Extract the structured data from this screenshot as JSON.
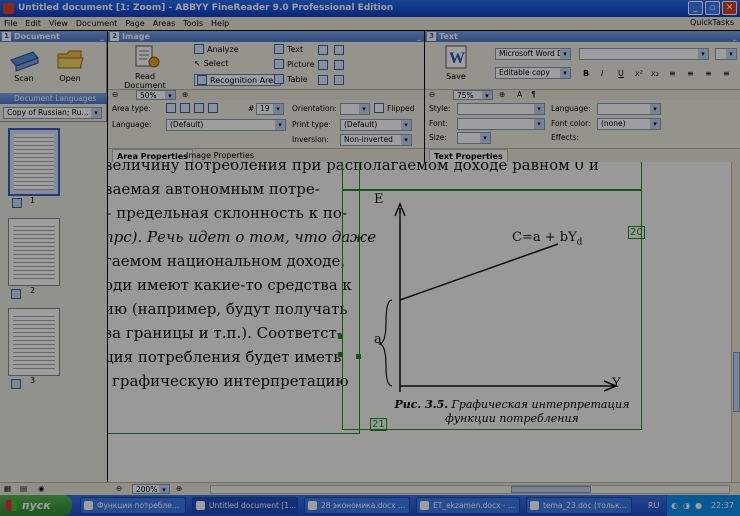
{
  "window": {
    "title": "Untitled document [1: Zoom] - ABBYY FineReader 9.0 Professional Edition",
    "min": "_",
    "max": "▫",
    "close": "✕"
  },
  "menu": {
    "items": [
      "File",
      "Edit",
      "View",
      "Document",
      "Page",
      "Areas",
      "Tools",
      "Help"
    ],
    "quicktasks": "QuickTasks"
  },
  "panels": {
    "document": {
      "num": "1",
      "title": "Document"
    },
    "image": {
      "num": "2",
      "title": "Image"
    },
    "text": {
      "num": "3",
      "title": "Text"
    }
  },
  "document_toolbar": {
    "scan": "Scan",
    "open": "Open",
    "languages_header": "Document Languages",
    "language_combo": "Copy of Russian; Ru..."
  },
  "image_toolbar": {
    "read_document": "Read Document",
    "analyze": "Analyze",
    "select": "Select",
    "recognition_area": "Recognition Area",
    "text": "Text",
    "picture": "Picture",
    "table": "Table",
    "zoom": "50%"
  },
  "text_toolbar": {
    "save": "Save",
    "format_combo": "Microsoft Word D",
    "mode_combo": "Editable copy",
    "zoom": "75%"
  },
  "area_properties": {
    "area_type_label": "Area type:",
    "number_sign": "#",
    "area_number": "19",
    "orientation_label": "Orientation:",
    "flipped_label": "Flipped",
    "language_label": "Language:",
    "language_value": "(Default)",
    "print_type_label": "Print type:",
    "print_type_value": "(Default)",
    "inversion_label": "Inversion:",
    "inversion_value": "Non-inverted"
  },
  "text_properties": {
    "style_label": "Style:",
    "language_label": "Language:",
    "font_label": "Font:",
    "font_color_label": "Font color:",
    "font_color_value": "(none)",
    "size_label": "Size:",
    "effects_label": "Effects:"
  },
  "tabs": {
    "area_properties": "Area Properties",
    "image_properties": "Image Properties",
    "text_properties": "Text Properties"
  },
  "thumbnails": [
    {
      "label": "1",
      "selected": true
    },
    {
      "label": "2",
      "selected": false
    },
    {
      "label": "3",
      "selected": false
    }
  ],
  "scan_text": {
    "lines": [
      "величину потребления при располагаемом доходе равном 0 и",
      "ваемая автономным потре-",
      "– предельная склонность к по-",
      "пpс). Речь идет о том, что даже",
      "гаемом национальном доходе,",
      "оди имеют какие-то средства к",
      "ию (например, будут получать",
      "за границы и т.п.). Соответст-",
      "ция потребления будет иметь",
      "графическую интерпретацию"
    ],
    "graph_e": "E",
    "graph_formula": "C=a + bY",
    "graph_formula_sub": "d",
    "graph_a": "a",
    "graph_y": "Y",
    "area_label_20": "20",
    "area_label_21": "21",
    "caption_bold": "Рис. 3.5.",
    "caption_rest": " Графическая интерпретация",
    "caption_line2": "функции потребления"
  },
  "bottom": {
    "zoom": "200%"
  },
  "taskbar": {
    "start": "пуск",
    "tasks": [
      "Функции потребле...",
      "Untitled document [1...",
      "28 экономика.docx ...",
      "ET_ekzamen.docx - ...",
      "tema_23.doc (тольк..."
    ],
    "lang": "RU",
    "time": "22:37"
  }
}
